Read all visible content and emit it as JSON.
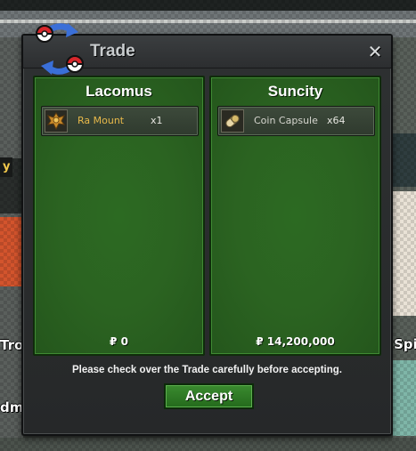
{
  "window": {
    "title": "Trade",
    "close_glyph": "✕",
    "logo_icon": "trade-arrows-pokeball-icon"
  },
  "offers": [
    {
      "player": "Lacomus",
      "item": {
        "icon": "ra-mount-icon",
        "name": "Ra Mount",
        "quantity": "x1"
      },
      "money": "₽ 0"
    },
    {
      "player": "Suncity",
      "item": {
        "icon": "coin-capsule-icon",
        "name": "Coin Capsule",
        "quantity": "x64"
      },
      "money": "₽ 14,200,000"
    }
  ],
  "notice": "Please check over the Trade carefully before accepting.",
  "accept_label": "Accept",
  "background_labels": {
    "left_tag": "y",
    "left_name_1": "Tro",
    "left_name_2": "dmt",
    "right_name": "Spi"
  },
  "colors": {
    "panel_green": "#2b6321",
    "accept_green": "#2f7d25",
    "item_name_gold": "#e7b84a"
  }
}
